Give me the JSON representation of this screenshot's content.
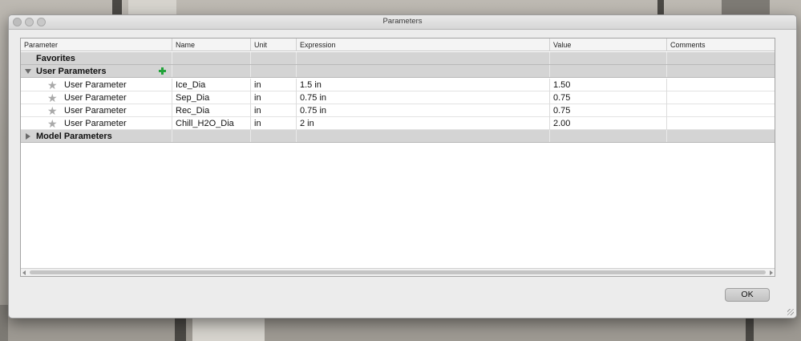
{
  "window": {
    "title": "Parameters"
  },
  "table": {
    "columns": [
      "Parameter",
      "Name",
      "Unit",
      "Expression",
      "Value",
      "Comments"
    ],
    "groups": {
      "favorites": {
        "label": "Favorites"
      },
      "user": {
        "label": "User Parameters",
        "rows": [
          {
            "parameter": "User Parameter",
            "name": "Ice_Dia",
            "unit": "in",
            "expression": "1.5 in",
            "value": "1.50",
            "comments": ""
          },
          {
            "parameter": "User Parameter",
            "name": "Sep_Dia",
            "unit": "in",
            "expression": "0.75 in",
            "value": "0.75",
            "comments": ""
          },
          {
            "parameter": "User Parameter",
            "name": "Rec_Dia",
            "unit": "in",
            "expression": "0.75 in",
            "value": "0.75",
            "comments": ""
          },
          {
            "parameter": "User Parameter",
            "name": "Chill_H2O_Dia",
            "unit": "in",
            "expression": "2 in",
            "value": "2.00",
            "comments": ""
          }
        ]
      },
      "model": {
        "label": "Model Parameters"
      }
    }
  },
  "buttons": {
    "ok": "OK"
  },
  "icons": {
    "add": "plus-icon",
    "favorite": "star-icon",
    "expanded": "disclosure-open-icon",
    "collapsed": "disclosure-closed-icon"
  },
  "colors": {
    "add_icon": "#22a33a",
    "group_row": "#d4d4d4",
    "star": "#a9a9a9"
  }
}
